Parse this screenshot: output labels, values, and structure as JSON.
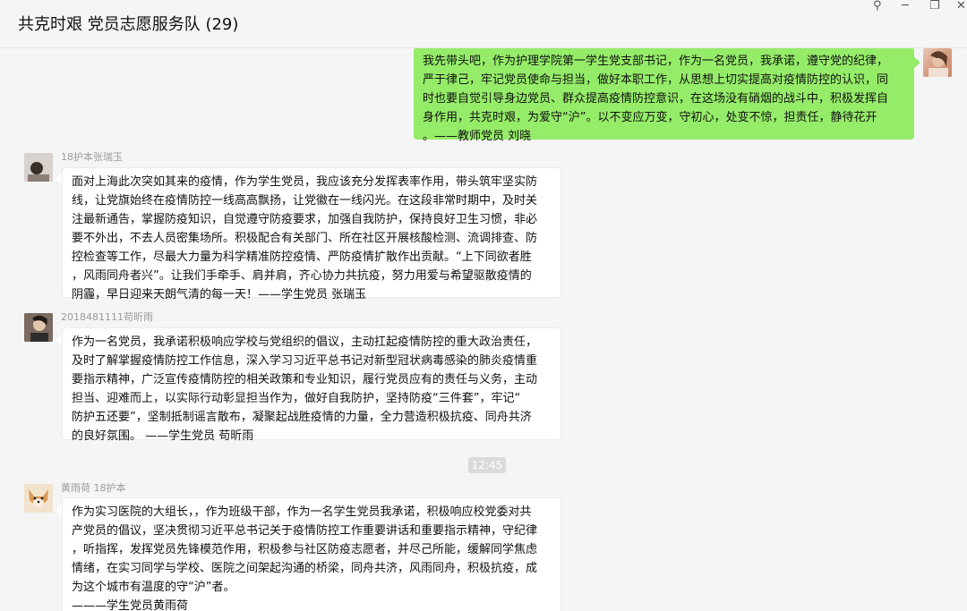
{
  "window": {
    "title": "共克时艰 党员志愿服务队 (29)",
    "pin_glyph": "⚲",
    "minimize_glyph": "─",
    "restore_glyph": "❐",
    "close_glyph": "✕"
  },
  "timestamp": "12:45",
  "messages": [
    {
      "side": "right",
      "sender": "",
      "lines": [
        "我先带头吧，作为护理学院第一学生党支部书记，作为一名党员，我承诺，遵守党的纪律，",
        "严于律己，牢记党员使命与担当，做好本职工作，从思想上切实提高对疫情防控的认识，同",
        "时也要自觉引导身边党员、群众提高疫情防控意识，在这场没有硝烟的战斗中，积极发挥自",
        "身作用，共克时艰，为爱守“沪”。以不变应万变，守初心，处变不惊，担责任，静待花开",
        "。——教师党员 刘晓"
      ]
    },
    {
      "side": "left",
      "sender": "18护本张瑞玉",
      "lines": [
        "面对上海此次突如其来的疫情，作为学生党员，我应该充分发挥表率作用，带头筑牢坚实防",
        "线，让党旗始终在疫情防控一线高高飘扬，让党徽在一线闪光。在这段非常时期中，及时关",
        "注最新通告，掌握防疫知识，自觉遵守防疫要求，加强自我防护，保持良好卫生习惯，非必",
        "要不外出，不去人员密集场所。积极配合有关部门、所在社区开展核酸检测、流调排查、防",
        "控检查等工作，尽最大力量为科学精准防控疫情、严防疫情扩散作出贡献。“上下同欲者胜",
        "，风雨同舟者兴”。让我们手牵手、肩并肩，齐心协力共抗疫，努力用爱与希望驱散疫情的",
        "阴霾，早日迎来天朗气清的每一天！——学生党员 张瑞玉"
      ]
    },
    {
      "side": "left",
      "sender": "2018481111苟昕雨",
      "lines": [
        "作为一名党员，我承诺积极响应学校与党组织的倡议，主动扛起疫情防控的重大政治责任，",
        "及时了解掌握疫情防控工作信息，深入学习习近平总书记对新型冠状病毒感染的肺炎疫情重",
        "要指示精神，广泛宣传疫情防控的相关政策和专业知识，履行党员应有的责任与义务，主动",
        "担当、迎难而上，以实际行动彰显担当作为，做好自我防护，坚持防疫“三件套”，牢记“",
        "防护五还要”，坚制抵制谣言散布，凝聚起战胜疫情的力量，全力营造积极抗疫、同舟共济",
        "的良好氛围。 ——学生党员 苟昕雨"
      ]
    },
    {
      "side": "left",
      "sender": "黄雨荷 18护本",
      "lines": [
        "作为实习医院的大组长，，作为班级干部，作为一名学生党员我承诺，积极响应校党委对共",
        "产党员的倡议，坚决贯彻习近平总书记关于疫情防控工作重要讲话和重要指示精神，守纪律",
        "，听指挥，发挥党员先锋模范作用，积极参与社区防疫志愿者，并尽己所能，缓解同学焦虑",
        "情绪，在实习同学与学校、医院之间架起沟通的桥梁，同舟共济，风雨同舟，积极抗疫，成",
        "为这个城市有温度的守“沪”者。",
        "———学生党员黄雨荷"
      ]
    }
  ]
}
